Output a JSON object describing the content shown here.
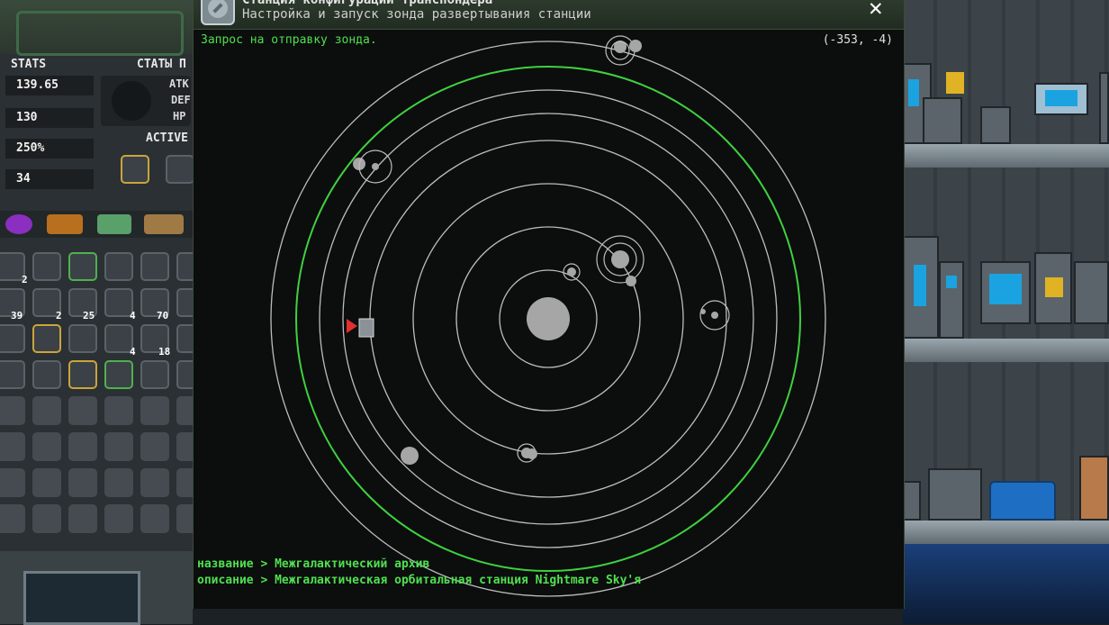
{
  "window": {
    "title": "Станция конфигурации транспондера",
    "subtitle": "Настройка и запуск зонда развертывания станции",
    "close_label": "✕",
    "status_text": "Запрос на отправку зонда.",
    "coordinates": "(-353, -4)",
    "info_name": "название > Межгалактический архив",
    "info_description": "описание > Межгалактическая орбитальная станция Nightmare Sky'я",
    "colors": {
      "accent": "#3fd03f",
      "orbit": "#bdbdbd",
      "body": "#a6a6a6",
      "marker": "#e03030"
    }
  },
  "inventory": {
    "stats_label": "STATS",
    "stats_right_label": "СТАТЫ П",
    "stats": [
      "139.65",
      "130",
      "250%",
      "34"
    ],
    "side_labels": [
      "АТК",
      "DEF",
      "HP"
    ],
    "active_label": "ACTIVE",
    "quantities": [
      "2",
      "39",
      "2",
      "25",
      "4",
      "70",
      "4",
      "18"
    ]
  }
}
